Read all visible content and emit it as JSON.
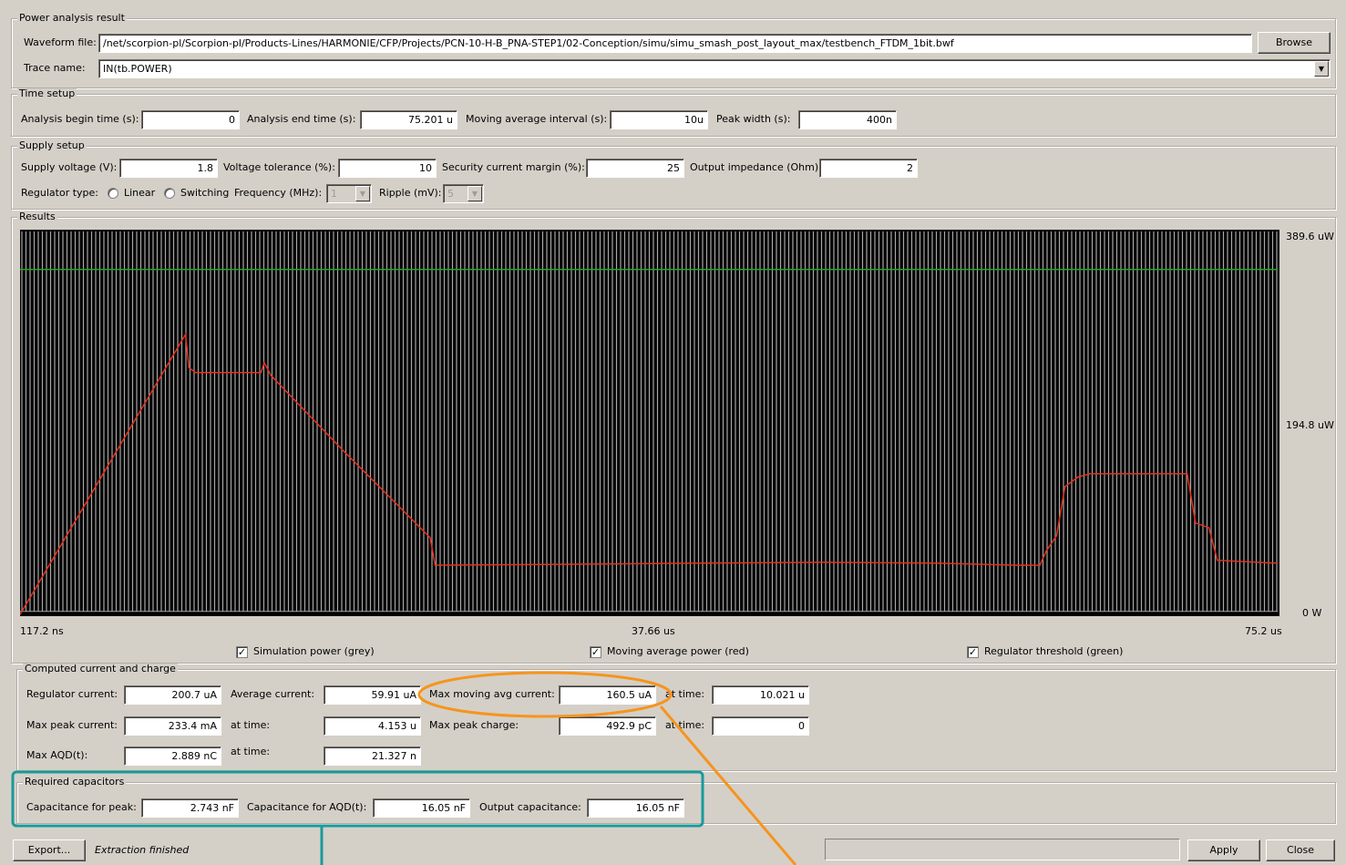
{
  "power_analysis": {
    "legend": "Power analysis result",
    "waveform_label": "Waveform file:",
    "waveform_value": "/net/scorpion-pl/Scorpion-pl/Products-Lines/HARMONIE/CFP/Projects/PCN-10-H-B_PNA-STEP1/02-Conception/simu/simu_smash_post_layout_max/testbench_FTDM_1bit.bwf",
    "browse_label": "Browse",
    "trace_label": "Trace name:",
    "trace_value": "IN(tb.POWER)"
  },
  "time_setup": {
    "legend": "Time setup",
    "begin_label": "Analysis begin time (s):",
    "begin_value": "0",
    "end_label": "Analysis end time (s):",
    "end_value": "75.201 u",
    "moving_label": "Moving average interval (s):",
    "moving_value": "10u",
    "peak_label": "Peak width (s):",
    "peak_value": "400n"
  },
  "supply_setup": {
    "legend": "Supply setup",
    "voltage_label": "Supply voltage (V):",
    "voltage_value": "1.8",
    "tolerance_label": "Voltage tolerance (%):",
    "tolerance_value": "10",
    "margin_label": "Security current margin (%):",
    "margin_value": "25",
    "impedance_label": "Output impedance (Ohm):",
    "impedance_value": "2",
    "regulator_label": "Regulator type:",
    "linear_label": "Linear",
    "switching_label": "Switching",
    "frequency_label": "Frequency (MHz):",
    "frequency_value": "1",
    "ripple_label": "Ripple (mV):",
    "ripple_value": "5"
  },
  "results": {
    "legend": "Results",
    "y_max_label": "389.6 uW",
    "y_mid_label": "194.8 uW",
    "y_min_label": "0 W",
    "x_start_label": "117.2 ns",
    "x_mid_label": "37.66 us",
    "x_end_label": "75.2 us",
    "cb_sim_label": "Simulation power (grey)",
    "cb_avg_label": "Moving average power (red)",
    "cb_reg_label": "Regulator threshold (green)",
    "check_glyph": "✓"
  },
  "chart_data": {
    "type": "line",
    "x_unit": "us",
    "y_unit": "uW",
    "xlim": [
      0.1172,
      75.2
    ],
    "ylim": [
      0,
      389.6
    ],
    "x_ticks": [
      "117.2 ns",
      "37.66 us",
      "75.2 us"
    ],
    "y_ticks": [
      "389.6 uW",
      "194.8 uW",
      "0 W"
    ],
    "background": "#000000",
    "series": [
      {
        "name": "Simulation power (grey)",
        "color": "#a8a8a8",
        "note_values": "dense periodic spikes reaching ~389.6 uW",
        "baseline": 3,
        "peak": 389.6
      },
      {
        "name": "Moving average power (red)",
        "color": "#e8301c",
        "x": [
          0.12,
          10.0,
          10.2,
          10.6,
          14.5,
          14.7,
          15.1,
          19.5,
          24.6,
          24.9,
          33.5,
          40.0,
          48.0,
          55.0,
          59.6,
          61.0,
          61.4,
          62.0,
          62.5,
          63.3,
          64.0,
          69.8,
          70.3,
          71.1,
          71.6,
          75.2
        ],
        "y": [
          0,
          285,
          251,
          246,
          246,
          256,
          243,
          165,
          78,
          50,
          51,
          52,
          53,
          52,
          50,
          50,
          65,
          80,
          130,
          140,
          143,
          143,
          93,
          88,
          55,
          52
        ]
      },
      {
        "name": "Regulator threshold (green)",
        "color": "#23a823",
        "x": [
          0.12,
          75.2
        ],
        "y": [
          351,
          351
        ]
      }
    ]
  },
  "computed": {
    "legend": "Computed current and charge",
    "reg_current_label": "Regulator current:",
    "reg_current_value": "200.7 uA",
    "avg_current_label": "Average current:",
    "avg_current_value": "59.91 uA",
    "max_moving_label": "Max moving avg current:",
    "max_moving_value": "160.5 uA",
    "at_time_label": "at time:",
    "at_time_1_value": "10.021 u",
    "max_peak_label": "Max peak current:",
    "max_peak_value": "233.4 mA",
    "at_time_2_value": "4.153 u",
    "max_charge_label": "Max peak charge:",
    "max_charge_value": "492.9 pC",
    "at_time_3_value": "0",
    "max_aqd_label": "Max AQD(t):",
    "max_aqd_value": "2.889 nC",
    "at_time_4_value": "21.327 n"
  },
  "required": {
    "legend": "Required capacitors",
    "peak_label": "Capacitance for peak:",
    "peak_value": "2.743 nF",
    "aqd_label": "Capacitance for AQD(t):",
    "aqd_value": "16.05 nF",
    "output_label": "Output capacitance:",
    "output_value": "16.05 nF"
  },
  "footer": {
    "export_label": "Export...",
    "status_text": "Extraction finished",
    "apply_label": "Apply",
    "close_label": "Close"
  },
  "annotations": {
    "orange_color": "#f7941d",
    "teal_color": "#1a9a9a"
  }
}
